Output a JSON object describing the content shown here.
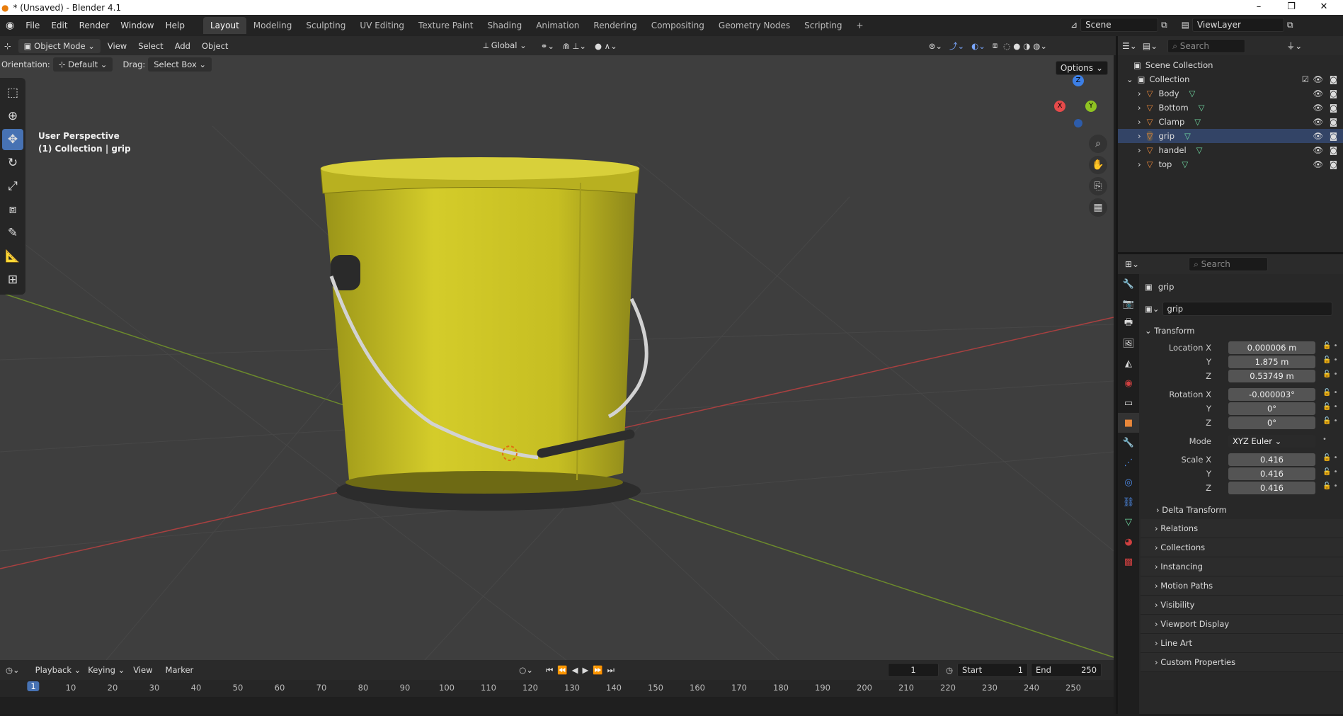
{
  "window": {
    "title": "* (Unsaved) - Blender 4.1",
    "controls": [
      "–",
      "❐",
      "✕"
    ]
  },
  "menu": [
    "File",
    "Edit",
    "Render",
    "Window",
    "Help"
  ],
  "workspaces": [
    {
      "label": "Layout",
      "active": true
    },
    {
      "label": "Modeling"
    },
    {
      "label": "Sculpting"
    },
    {
      "label": "UV Editing"
    },
    {
      "label": "Texture Paint"
    },
    {
      "label": "Shading"
    },
    {
      "label": "Animation"
    },
    {
      "label": "Rendering"
    },
    {
      "label": "Compositing"
    },
    {
      "label": "Geometry Nodes"
    },
    {
      "label": "Scripting"
    }
  ],
  "add_workspace": "+",
  "scene": "Scene",
  "view_layer": "ViewLayer",
  "header3d": {
    "mode": "Object Mode",
    "menus": [
      "View",
      "Select",
      "Add",
      "Object"
    ],
    "transform_orientation": "Global",
    "options": "Options"
  },
  "subheader": {
    "orientation_label": "Orientation:",
    "orientation_value": "Default",
    "drag_label": "Drag:",
    "drag_value": "Select Box"
  },
  "viewport": {
    "perspective": "User Perspective",
    "collection": "(1) Collection | grip",
    "gizmo": {
      "x": "X",
      "y": "Y",
      "z": "Z"
    }
  },
  "outliner": {
    "search_placeholder": "Search",
    "root": "Scene Collection",
    "collection": "Collection",
    "objects": [
      "Body",
      "Bottom",
      "Clamp",
      "grip",
      "handel",
      "top"
    ]
  },
  "properties": {
    "search_placeholder": "Search",
    "object_name": "grip",
    "data_name": "grip",
    "transform_title": "Transform",
    "location": {
      "label": "Location X",
      "x": "0.000006 m",
      "y": "1.875 m",
      "z": "0.53749 m"
    },
    "rotation": {
      "label": "Rotation X",
      "x": "-0.000003°",
      "y": "0°",
      "z": "0°"
    },
    "mode": {
      "label": "Mode",
      "value": "XYZ Euler"
    },
    "scale": {
      "label": "Scale X",
      "x": "0.416",
      "y": "0.416",
      "z": "0.416"
    },
    "axis_y": "Y",
    "axis_z": "Z",
    "delta": "Delta Transform",
    "sections": [
      "Relations",
      "Collections",
      "Instancing",
      "Motion Paths",
      "Visibility",
      "Viewport Display",
      "Line Art",
      "Custom Properties"
    ]
  },
  "timeline": {
    "menus": [
      "Playback",
      "Keying",
      "View",
      "Marker"
    ],
    "current_frame": "1",
    "start_label": "Start",
    "start": "1",
    "end_label": "End",
    "end": "250",
    "ticks": [
      "10",
      "20",
      "30",
      "40",
      "50",
      "60",
      "70",
      "80",
      "90",
      "100",
      "110",
      "120",
      "130",
      "140",
      "150",
      "160",
      "170",
      "180",
      "190",
      "200",
      "210",
      "220",
      "230",
      "240",
      "250"
    ],
    "playhead": "1"
  },
  "colors": {
    "bucket": "#c8c024",
    "accent": "#4772b3",
    "x_axis": "#e64a4a",
    "y_axis": "#8fc322",
    "z_axis": "#3c7fe6"
  }
}
